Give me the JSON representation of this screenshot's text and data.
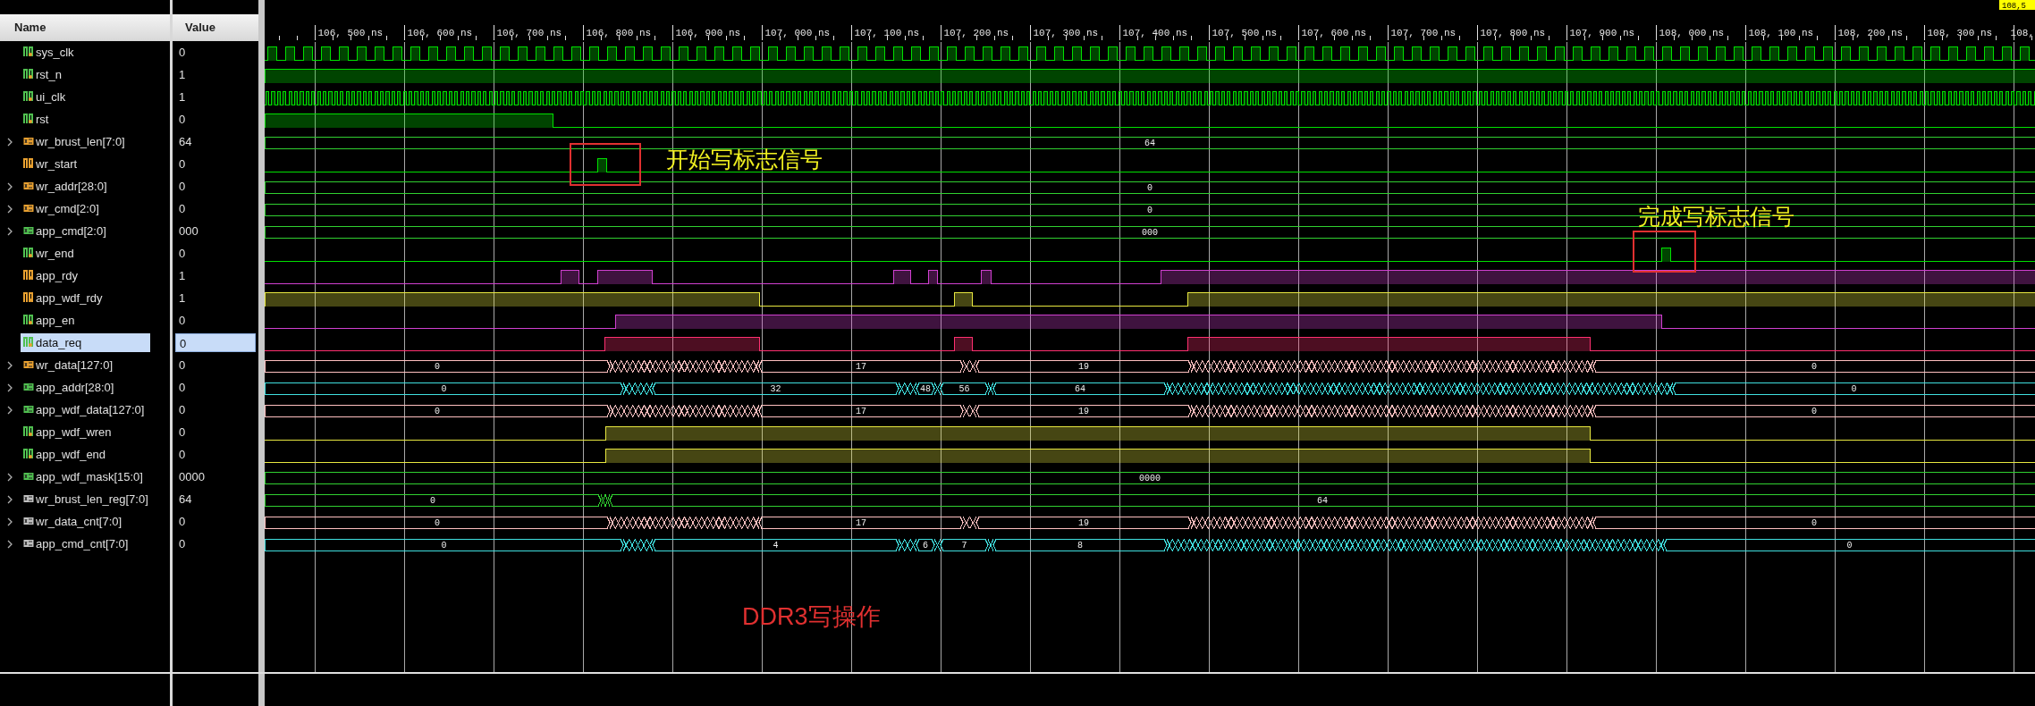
{
  "columns": [
    "Name",
    "Value"
  ],
  "timeline": {
    "labels": [
      "106, 500 ns",
      "106, 600 ns",
      "106, 700 ns",
      "106, 800 ns",
      "106, 900 ns",
      "107, 000 ns",
      "107, 100 ns",
      "107, 200 ns",
      "107, 300 ns",
      "107, 400 ns",
      "107, 500 ns",
      "107, 600 ns",
      "107, 700 ns",
      "107, 800 ns",
      "107, 900 ns",
      "108, 000 ns",
      "108, 100 ns",
      "108, 200 ns",
      "108, 300 ns",
      "108,"
    ],
    "cursor": "108,5"
  },
  "signals": [
    {
      "name": "sys_clk",
      "value": "0",
      "kind": "clock",
      "color": "#00e000",
      "icon": {
        "color": "#50c050"
      },
      "selected": false
    },
    {
      "name": "rst_n",
      "value": "1",
      "kind": "bit",
      "color": "#00e000",
      "icon": {
        "color": "#50c050"
      },
      "selected": false
    },
    {
      "name": "ui_clk",
      "value": "1",
      "kind": "clock",
      "color": "#00e000",
      "icon": {
        "color": "#50c050"
      },
      "selected": false
    },
    {
      "name": "rst",
      "value": "0",
      "kind": "bit",
      "color": "#00e000",
      "icon": {
        "color": "#50c050"
      },
      "selected": false
    },
    {
      "name": "wr_brust_len[7:0]",
      "value": "64",
      "kind": "bus",
      "color": "#30d030",
      "icon": {
        "color": "#e8a030"
      },
      "selected": false,
      "segments": [
        "64"
      ]
    },
    {
      "name": "wr_start",
      "value": "0",
      "kind": "bit",
      "color": "#00e000",
      "icon": {
        "color": "#e8a030"
      },
      "selected": false
    },
    {
      "name": "wr_addr[28:0]",
      "value": "0",
      "kind": "bus",
      "color": "#30d030",
      "icon": {
        "color": "#e8a030"
      },
      "selected": false,
      "segments": [
        "0"
      ]
    },
    {
      "name": "wr_cmd[2:0]",
      "value": "0",
      "kind": "bus",
      "color": "#30d030",
      "icon": {
        "color": "#e8a030"
      },
      "selected": false,
      "segments": [
        "0"
      ]
    },
    {
      "name": "app_cmd[2:0]",
      "value": "000",
      "kind": "bus",
      "color": "#30d030",
      "icon": {
        "color": "#50c050"
      },
      "selected": false,
      "segments": [
        "000"
      ]
    },
    {
      "name": "wr_end",
      "value": "0",
      "kind": "bit",
      "color": "#00e000",
      "icon": {
        "color": "#50c050"
      },
      "selected": false
    },
    {
      "name": "app_rdy",
      "value": "1",
      "kind": "bit",
      "color": "#d040d0",
      "icon": {
        "color": "#e8a030"
      },
      "selected": false
    },
    {
      "name": "app_wdf_rdy",
      "value": "1",
      "kind": "bit",
      "color": "#e8e840",
      "icon": {
        "color": "#e8a030"
      },
      "selected": false
    },
    {
      "name": "app_en",
      "value": "0",
      "kind": "bit",
      "color": "#d040d0",
      "icon": {
        "color": "#50c050"
      },
      "selected": false
    },
    {
      "name": "data_req",
      "value": "0",
      "kind": "bit",
      "color": "#ff3070",
      "icon": {
        "color": "#50c050"
      },
      "selected": true
    },
    {
      "name": "wr_data[127:0]",
      "value": "0",
      "kind": "bus",
      "color": "#ffc0c0",
      "icon": {
        "color": "#e8a030"
      },
      "selected": false,
      "segments": [
        "0",
        "17",
        "19",
        "0"
      ]
    },
    {
      "name": "app_addr[28:0]",
      "value": "0",
      "kind": "bus",
      "color": "#40e0e0",
      "icon": {
        "color": "#50c050"
      },
      "selected": false,
      "segments": [
        "0",
        "32",
        "48",
        "56",
        "64",
        "0"
      ]
    },
    {
      "name": "app_wdf_data[127:0]",
      "value": "0",
      "kind": "bus",
      "color": "#ffc0c0",
      "icon": {
        "color": "#50c050"
      },
      "selected": false,
      "segments": [
        "0",
        "17",
        "19",
        "0"
      ]
    },
    {
      "name": "app_wdf_wren",
      "value": "0",
      "kind": "bit",
      "color": "#e8e840",
      "icon": {
        "color": "#50c050"
      },
      "selected": false
    },
    {
      "name": "app_wdf_end",
      "value": "0",
      "kind": "bit",
      "color": "#e8e840",
      "icon": {
        "color": "#50c050"
      },
      "selected": false
    },
    {
      "name": "app_wdf_mask[15:0]",
      "value": "0000",
      "kind": "bus",
      "color": "#30d030",
      "icon": {
        "color": "#50c050"
      },
      "selected": false,
      "segments": [
        "0000"
      ]
    },
    {
      "name": "wr_brust_len_reg[7:0]",
      "value": "64",
      "kind": "bus",
      "color": "#30d030",
      "icon": {
        "color": "#c0c0c0"
      },
      "selected": false,
      "segments": [
        "0",
        "64"
      ]
    },
    {
      "name": "wr_data_cnt[7:0]",
      "value": "0",
      "kind": "bus",
      "color": "#ffc0c0",
      "icon": {
        "color": "#c0c0c0"
      },
      "selected": false,
      "segments": [
        "0",
        "17",
        "19",
        "0"
      ]
    },
    {
      "name": "app_cmd_cnt[7:0]",
      "value": "0",
      "kind": "bus",
      "color": "#40e0e0",
      "icon": {
        "color": "#c0c0c0"
      },
      "selected": false,
      "segments": [
        "0",
        "4",
        "6",
        "7",
        "8",
        "0"
      ]
    }
  ],
  "annotations": [
    {
      "kind": "boxed_note",
      "text": "开始写标志信号"
    },
    {
      "kind": "boxed_note",
      "text": "完成写标志信号"
    },
    {
      "kind": "caption",
      "text": "DDR3写操作"
    }
  ]
}
